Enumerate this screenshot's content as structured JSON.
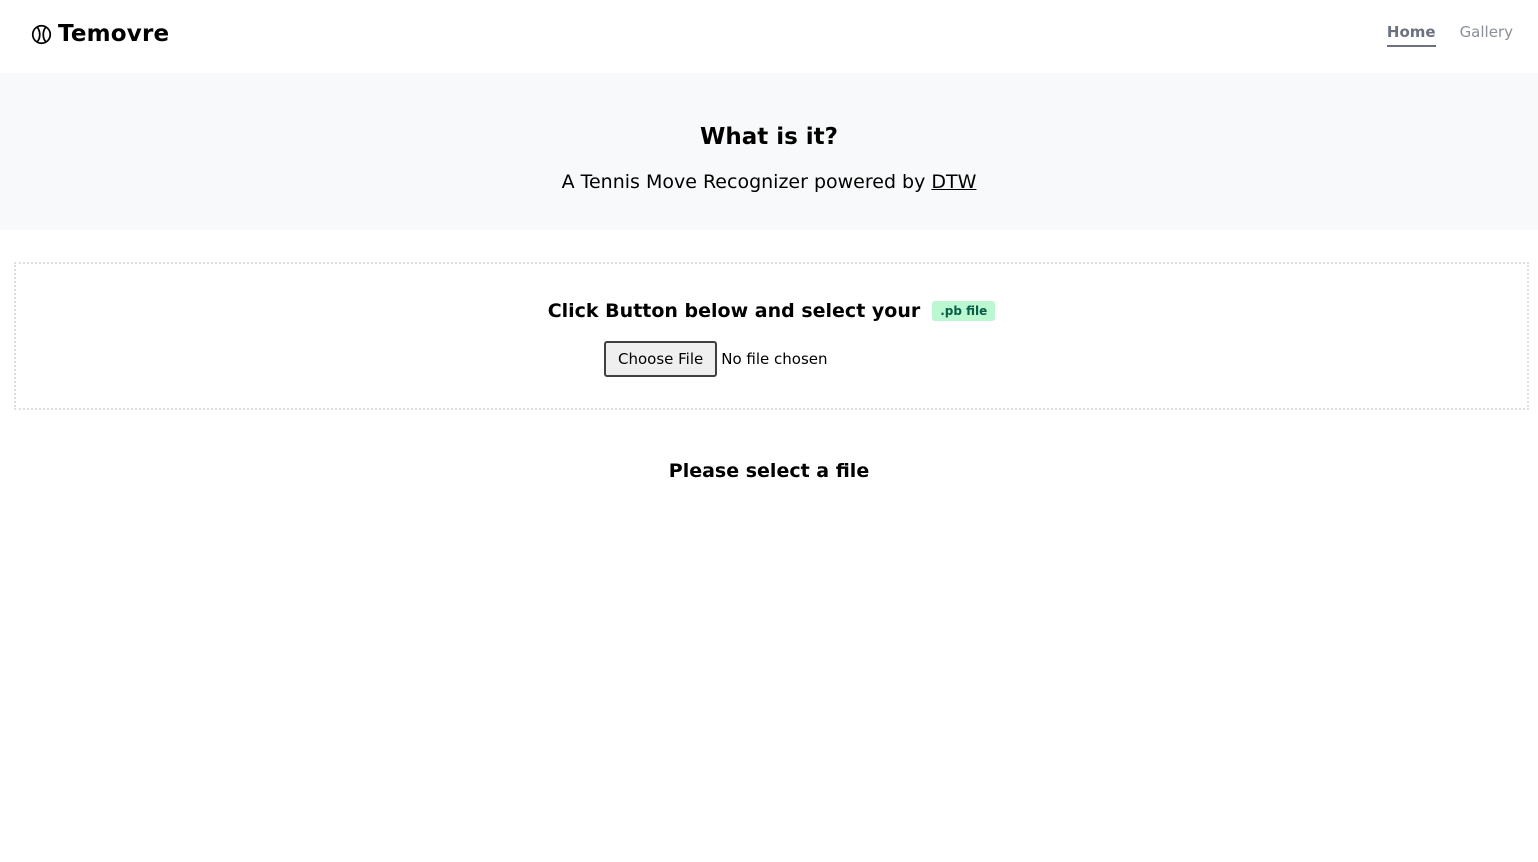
{
  "header": {
    "brand": "Temovre",
    "brand_icon": "tennis-ball-icon",
    "nav": [
      {
        "label": "Home",
        "active": true
      },
      {
        "label": "Gallery",
        "active": false
      }
    ]
  },
  "hero": {
    "title": "What is it?",
    "subtitle_prefix": "A Tennis Move Recognizer powered by ",
    "subtitle_link": "DTW"
  },
  "upload": {
    "title": "Click Button below and select your",
    "badge": ".pb file",
    "button_label": "Choose File",
    "file_status": "No file chosen"
  },
  "result": {
    "message": "Please select a file"
  },
  "colors": {
    "hero_bg": "#f8f9fa",
    "badge_bg": "#bbf7d0",
    "nav_active": "#6b7280"
  }
}
